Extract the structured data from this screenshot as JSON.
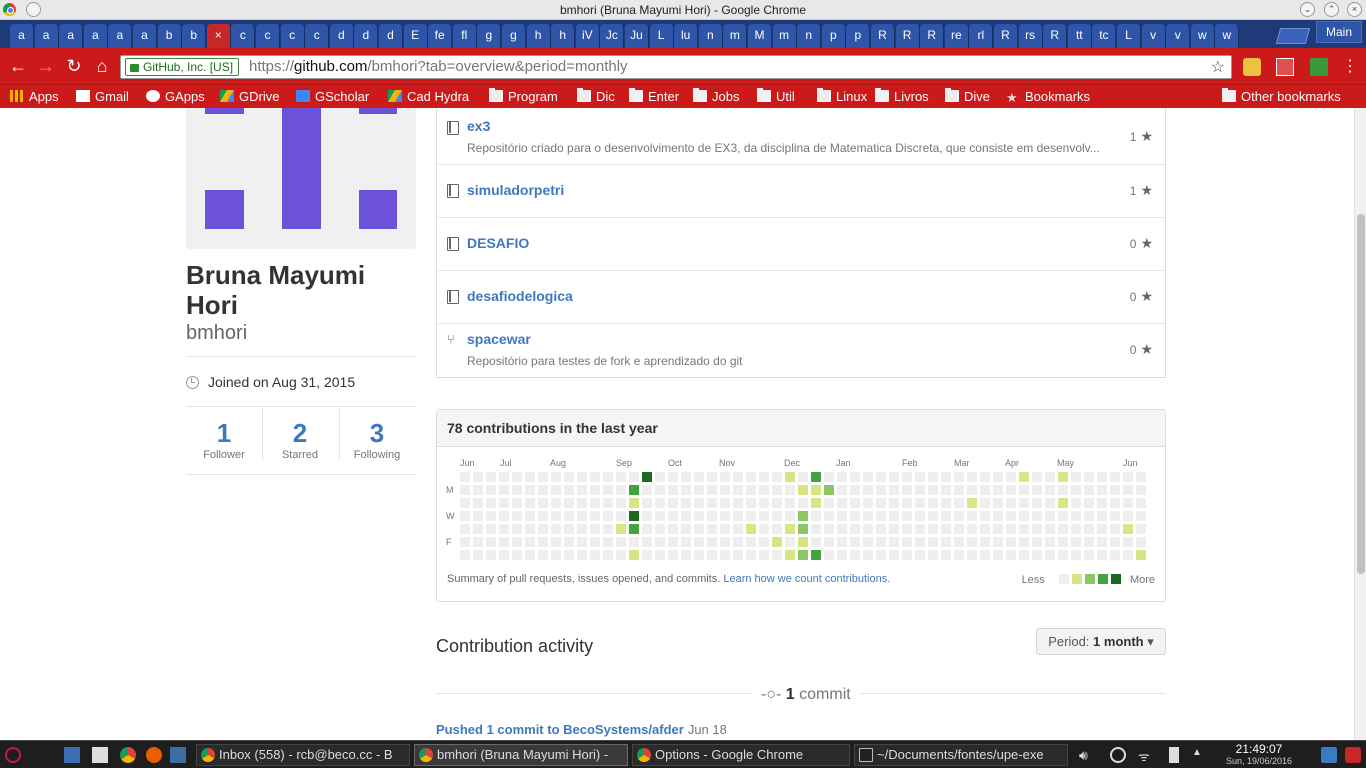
{
  "window": {
    "title": "bmhori (Bruna Mayumi Hori) - Google Chrome"
  },
  "tabs": [
    "a",
    "a",
    "a",
    "a",
    "a",
    "a",
    "b",
    "b",
    "×",
    "c",
    "c",
    "c",
    "c",
    "d",
    "d",
    "d",
    "E",
    "fe",
    "fl",
    "g",
    "g",
    "h",
    "h",
    "iV",
    "Jc",
    "Ju",
    "L",
    "lu",
    "n",
    "m",
    "M",
    "m",
    "n",
    "p",
    "p",
    "R",
    "R",
    "R",
    "re",
    "rl",
    "R",
    "rs",
    "R",
    "tt",
    "tc",
    "L",
    "v",
    "v",
    "w",
    "w"
  ],
  "active_tab_index": 8,
  "profile": "Main",
  "toolbar": {
    "secure_label": "GitHub, Inc. [US]",
    "url_scheme": "https://",
    "url_host": "github.com",
    "url_path": "/bmhori?tab=overview&period=monthly"
  },
  "bookmarks": [
    {
      "label": "Apps",
      "icon": "apps-grid-icon"
    },
    {
      "label": "Gmail",
      "icon": "gmail-icon"
    },
    {
      "label": "GApps",
      "icon": "google-icon"
    },
    {
      "label": "GDrive",
      "icon": "drive-icon"
    },
    {
      "label": "GScholar",
      "icon": "scholar-icon"
    },
    {
      "label": "Cad Hydra",
      "icon": "drive-icon"
    },
    {
      "label": "Program",
      "icon": "folder-icon"
    },
    {
      "label": "Dic",
      "icon": "folder-icon"
    },
    {
      "label": "Enter",
      "icon": "folder-icon"
    },
    {
      "label": "Jobs",
      "icon": "folder-icon"
    },
    {
      "label": "Util",
      "icon": "folder-icon"
    },
    {
      "label": "Linux",
      "icon": "folder-icon"
    },
    {
      "label": "Livros",
      "icon": "folder-icon"
    },
    {
      "label": "Dive",
      "icon": "folder-icon"
    },
    {
      "label": "Bookmarks",
      "icon": "star-icon"
    }
  ],
  "other_bookmarks": "Other bookmarks",
  "profile_card": {
    "fullname": "Bruna Mayumi Hori",
    "username": "bmhori",
    "joined": "Joined on Aug 31, 2015",
    "stats": [
      {
        "num": "1",
        "label": "Follower"
      },
      {
        "num": "2",
        "label": "Starred"
      },
      {
        "num": "3",
        "label": "Following"
      }
    ]
  },
  "repos": [
    {
      "name": "ex3",
      "desc": "Repositório criado para o desenvolvimento de EX3, da disciplina de Matematica Discreta, que consiste em desenvolv...",
      "stars": "1",
      "fork": false
    },
    {
      "name": "simuladorpetri",
      "desc": "",
      "stars": "1",
      "fork": false
    },
    {
      "name": "DESAFIO",
      "desc": "",
      "stars": "0",
      "fork": false
    },
    {
      "name": "desafiodelogica",
      "desc": "",
      "stars": "0",
      "fork": false
    },
    {
      "name": "spacewar",
      "desc": "Repositório para testes de fork e aprendizado do git",
      "stars": "0",
      "fork": true
    }
  ],
  "contributions": {
    "heading": "78 contributions in the last year",
    "months": [
      "Jun",
      "Jul",
      "Aug",
      "Sep",
      "Oct",
      "Nov",
      "Dec",
      "Jan",
      "Feb",
      "Mar",
      "Apr",
      "May",
      "Jun"
    ],
    "days": [
      "M",
      "W",
      "F"
    ],
    "footer": "Summary of pull requests, issues opened, and commits.",
    "footer_link": "Learn how we count contributions.",
    "legend_less": "Less",
    "legend_more": "More",
    "palette": [
      "#eeeeee",
      "#d6e685",
      "#8cc665",
      "#44a340",
      "#1e6823"
    ],
    "active_cells": [
      {
        "week": 14,
        "day": 0,
        "level": 4
      },
      {
        "week": 13,
        "day": 1,
        "level": 3
      },
      {
        "week": 13,
        "day": 2,
        "level": 1
      },
      {
        "week": 13,
        "day": 3,
        "level": 4
      },
      {
        "week": 12,
        "day": 4,
        "level": 1
      },
      {
        "week": 13,
        "day": 4,
        "level": 3
      },
      {
        "week": 13,
        "day": 6,
        "level": 1
      },
      {
        "week": 22,
        "day": 4,
        "level": 1
      },
      {
        "week": 24,
        "day": 5,
        "level": 1
      },
      {
        "week": 25,
        "day": 0,
        "level": 1
      },
      {
        "week": 25,
        "day": 4,
        "level": 1
      },
      {
        "week": 25,
        "day": 6,
        "level": 1
      },
      {
        "week": 26,
        "day": 1,
        "level": 1
      },
      {
        "week": 26,
        "day": 3,
        "level": 2
      },
      {
        "week": 26,
        "day": 4,
        "level": 2
      },
      {
        "week": 26,
        "day": 5,
        "level": 1
      },
      {
        "week": 26,
        "day": 6,
        "level": 2
      },
      {
        "week": 27,
        "day": 0,
        "level": 3
      },
      {
        "week": 27,
        "day": 1,
        "level": 1
      },
      {
        "week": 27,
        "day": 2,
        "level": 1
      },
      {
        "week": 27,
        "day": 6,
        "level": 3
      },
      {
        "week": 28,
        "day": 1,
        "level": 2
      },
      {
        "week": 39,
        "day": 2,
        "level": 1
      },
      {
        "week": 43,
        "day": 0,
        "level": 1
      },
      {
        "week": 46,
        "day": 0,
        "level": 1
      },
      {
        "week": 46,
        "day": 2,
        "level": 1
      },
      {
        "week": 51,
        "day": 4,
        "level": 1
      },
      {
        "week": 52,
        "day": 6,
        "level": 1
      }
    ]
  },
  "activity": {
    "title": "Contribution activity",
    "period_label": "Period:",
    "period_value": "1 month",
    "commit_count": "1",
    "commit_word": "commit",
    "pushed": "Pushed 1 commit to BecoSystems/afder",
    "pushed_date": "Jun 18"
  },
  "taskbar": {
    "tasks": [
      {
        "label": "Inbox (558) - rcb@beco.cc - B",
        "active": false
      },
      {
        "label": "bmhori (Bruna Mayumi Hori) -",
        "active": true
      },
      {
        "label": "Options - Google Chrome",
        "active": false
      },
      {
        "label": "~/Documents/fontes/upe-exe",
        "active": false
      }
    ],
    "time": "21:49:07",
    "date": "Sun, 19/06/2016"
  }
}
